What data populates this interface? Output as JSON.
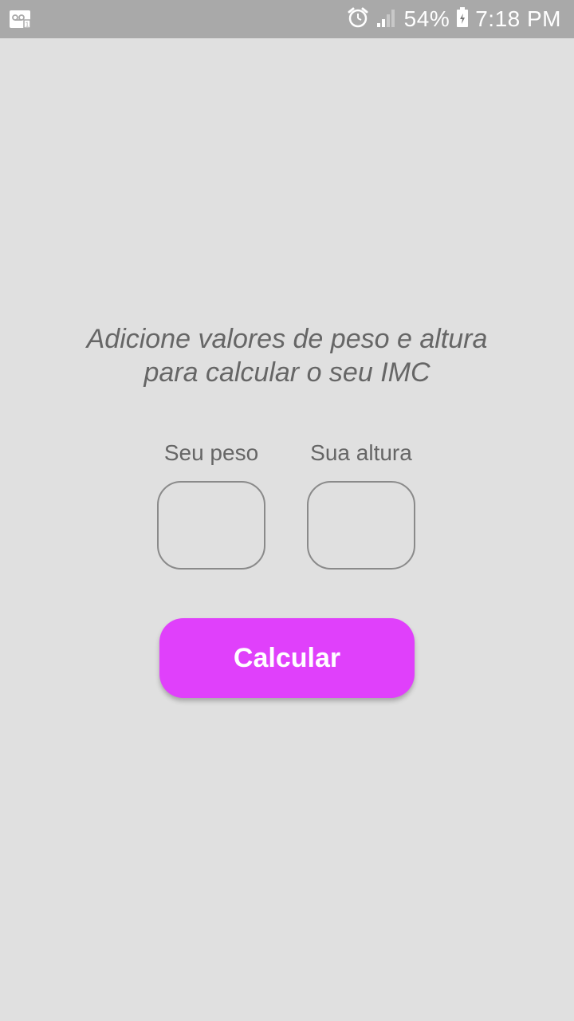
{
  "status_bar": {
    "left_icon": "voicemail-notification-icon",
    "alarm_icon": "alarm-clock-icon",
    "signal_icon": "cell-signal-icon",
    "battery_percent": "54%",
    "battery_icon": "battery-charging-icon",
    "time": "7:18 PM"
  },
  "main": {
    "title_line1": "Adicione valores de peso e altura",
    "title_line2": "para calcular o seu IMC",
    "weight_label": "Seu peso",
    "weight_value": "",
    "height_label": "Sua altura",
    "height_value": "",
    "calculate_label": "Calcular"
  },
  "colors": {
    "background": "#e0e0e0",
    "status_bar": "#a9a9a9",
    "accent": "#e040fb",
    "text": "#666666"
  }
}
